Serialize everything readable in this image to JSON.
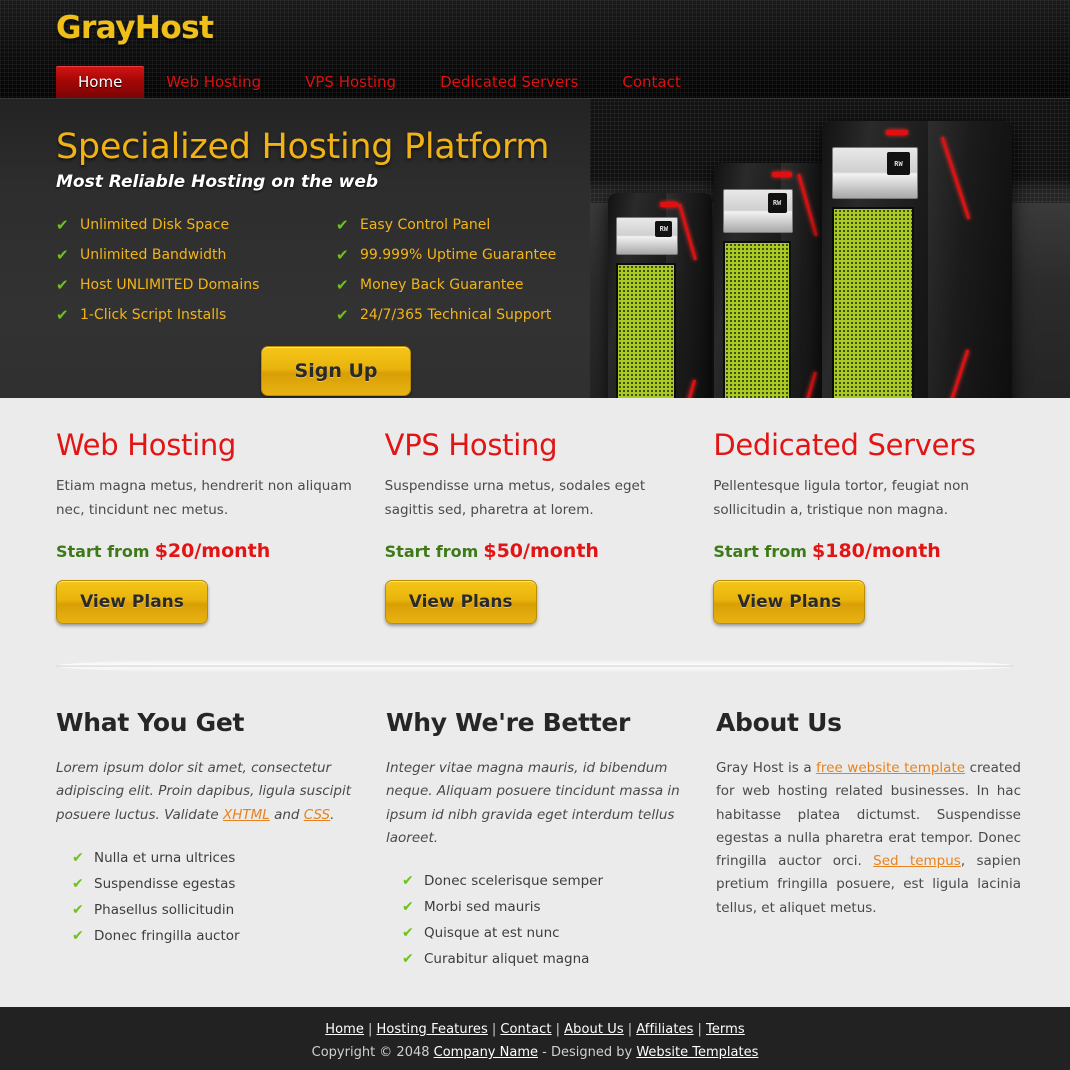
{
  "header": {
    "logo": "GrayHost",
    "nav": [
      {
        "label": "Home",
        "active": true
      },
      {
        "label": "Web Hosting",
        "active": false
      },
      {
        "label": "VPS Hosting",
        "active": false
      },
      {
        "label": "Dedicated Servers",
        "active": false
      },
      {
        "label": "Contact",
        "active": false
      }
    ]
  },
  "hero": {
    "title": "Specialized Hosting Platform",
    "subtitle": "Most Reliable Hosting on the web",
    "features": [
      "Unlimited Disk Space",
      "Easy Control Panel",
      "Unlimited Bandwidth",
      "99.999% Uptime Guarantee",
      "Host UNLIMITED Domains",
      "Money Back Guarantee",
      "1-Click Script Installs",
      "24/7/365 Technical Support"
    ],
    "signup_label": "Sign Up",
    "tick_icon": "check-icon",
    "server_badge_text": "RW"
  },
  "plans": [
    {
      "title": "Web Hosting",
      "desc": "Etiam magna metus, hendrerit non aliquam nec, tincidunt nec metus.",
      "price_prefix": "Start from",
      "price": "$20/month",
      "button": "View Plans"
    },
    {
      "title": "VPS Hosting",
      "desc": "Suspendisse urna metus, sodales eget sagittis sed, pharetra at lorem.",
      "price_prefix": "Start from",
      "price": "$50/month",
      "button": "View Plans"
    },
    {
      "title": "Dedicated Servers",
      "desc": "Pellentesque ligula tortor, feugiat non sollicitudin a, tristique non magna.",
      "price_prefix": "Start from",
      "price": "$180/month",
      "button": "View Plans"
    }
  ],
  "infos": {
    "what_you_get": {
      "title": "What You Get",
      "text_1": "Lorem ipsum dolor sit amet, consectetur adipiscing elit. Proin dapibus, ligula suscipit posuere luctus. Validate ",
      "link_1": "XHTML",
      "text_2": " and ",
      "link_2": "CSS",
      "text_3": ".",
      "list": [
        "Nulla et urna ultrices",
        "Suspendisse egestas",
        "Phasellus sollicitudin",
        "Donec fringilla auctor"
      ]
    },
    "why_better": {
      "title": "Why We're Better",
      "text": "Integer vitae magna mauris, id bibendum neque. Aliquam posuere tincidunt massa in ipsum id nibh gravida eget interdum tellus laoreet.",
      "list": [
        "Donec scelerisque semper",
        "Morbi sed mauris",
        "Quisque at est nunc",
        "Curabitur aliquet magna"
      ]
    },
    "about_us": {
      "title": "About Us",
      "text_1": "Gray Host is a ",
      "link_1": "free website template",
      "text_2": " created for web hosting related businesses. In hac habitasse platea dictumst. Suspendisse egestas a nulla pharetra erat tempor. Donec fringilla auctor orci. ",
      "link_2": "Sed tempus",
      "text_3": ", sapien pretium fringilla posuere, est ligula lacinia tellus, et aliquet metus."
    }
  },
  "footer": {
    "links": [
      "Home",
      "Hosting Features",
      "Contact",
      "About Us",
      "Affiliates",
      "Terms"
    ],
    "separator": "|",
    "copy_prefix": "Copyright © 2048 ",
    "company": "Company Name",
    "copy_middle": " - Designed by ",
    "designer": "Website Templates"
  },
  "colors": {
    "brand_gold": "#f0c018",
    "accent_red": "#e21414",
    "accent_green": "#6cc417",
    "link_orange": "#e8821e",
    "hero_bg": "#2f2f2f",
    "page_bg": "#ebebeb",
    "footer_bg": "#222222"
  }
}
